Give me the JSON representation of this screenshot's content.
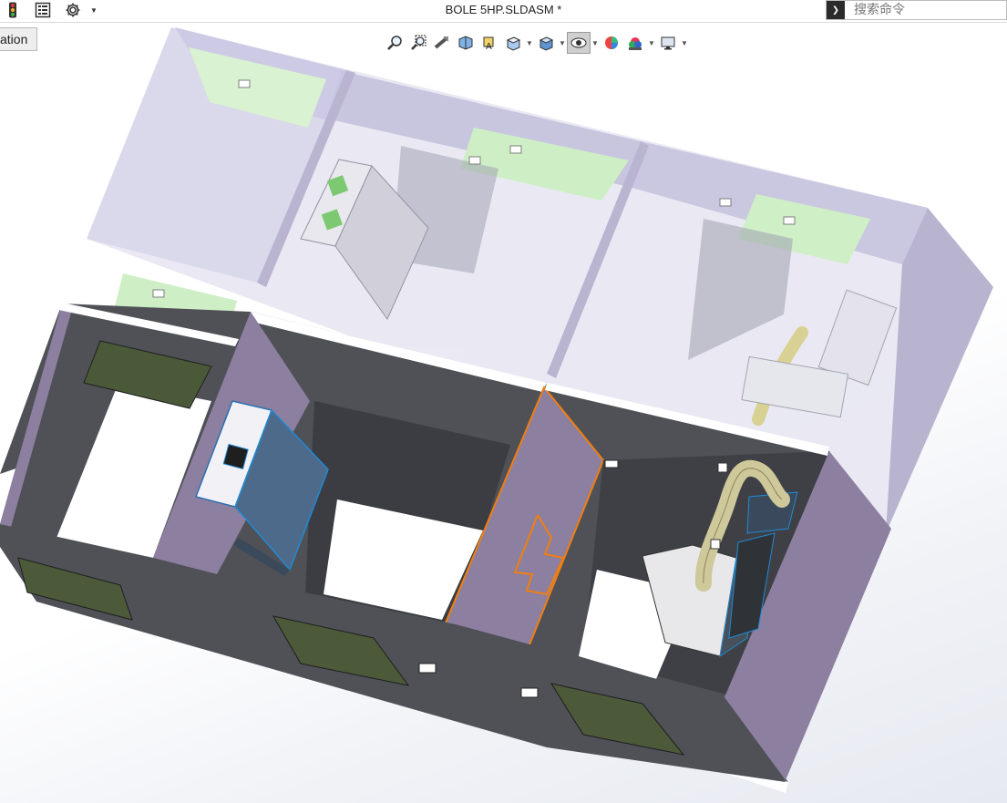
{
  "window": {
    "title": "BOLE 5HP.SLDASM *"
  },
  "quick_access": {
    "icons": [
      "traffic-light-icon",
      "document-properties-icon",
      "gear-icon",
      "dropdown-caret-icon"
    ]
  },
  "search": {
    "prompt_icon": "command-prompt-icon",
    "placeholder": "搜索命令"
  },
  "tab": {
    "label": "ation"
  },
  "view_toolbar": {
    "buttons": [
      "zoom-to-fit-icon",
      "zoom-to-area-icon",
      "previous-view-icon",
      "section-view-icon",
      "dynamic-annotation-icon",
      "view-orientation-icon",
      "display-style-icon",
      "hide-show-items-icon",
      "edit-appearance-icon",
      "apply-scene-icon",
      "view-settings-icon"
    ],
    "active": "hide-show-items-icon"
  },
  "colors": {
    "orange_selection": "#f07f10",
    "wall_purple": "#8c7fa0",
    "wall_dark": "#4d4f55",
    "door_green": "#56643f",
    "ghost_wall": "#cfcde6",
    "ghost_green": "#c9efc0",
    "duct_yellow": "#cfc89a",
    "cad_blue": "#1e8ad6"
  }
}
